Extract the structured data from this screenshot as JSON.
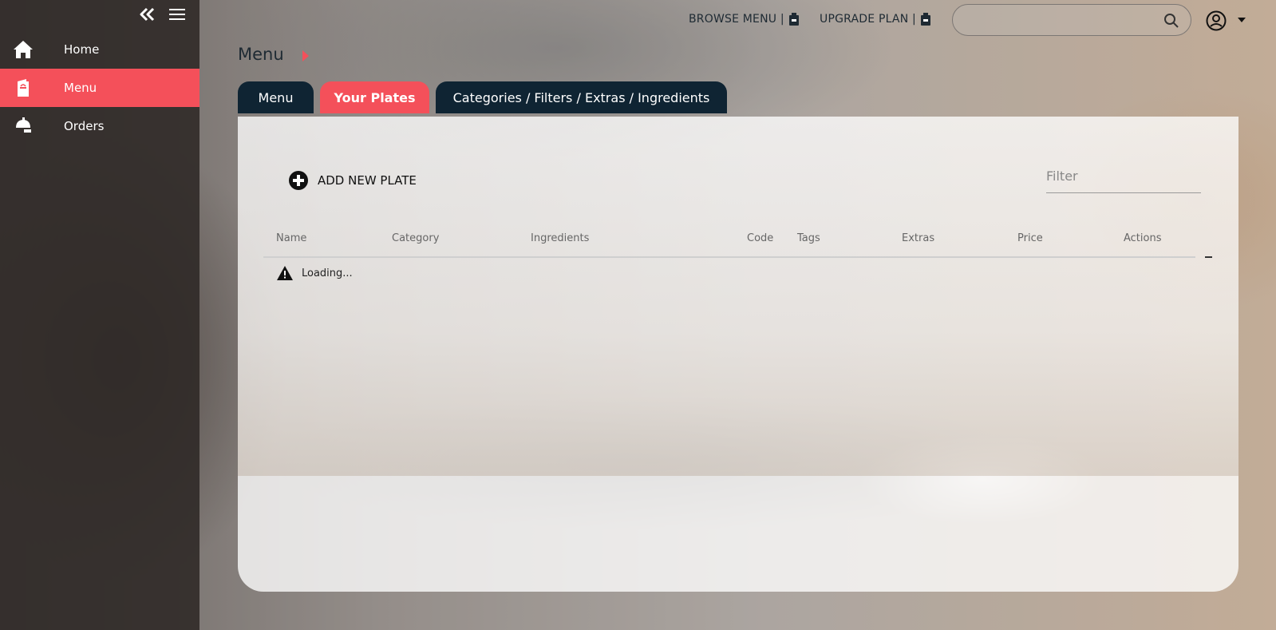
{
  "sidebar": {
    "items": [
      {
        "label": "Home",
        "icon": "home-icon"
      },
      {
        "label": "Menu",
        "icon": "menu-book-icon"
      },
      {
        "label": "Orders",
        "icon": "room-service-icon"
      }
    ],
    "active_index": 1
  },
  "topbar": {
    "browse_menu": "BROWSE MENU |",
    "upgrade_plan": "UPGRADE PLAN |",
    "search_placeholder": ""
  },
  "page": {
    "title": "Menu"
  },
  "tabs": [
    {
      "label": "Menu"
    },
    {
      "label": "Your Plates",
      "active": true
    },
    {
      "label": "Categories / Filters / Extras / Ingredients"
    }
  ],
  "panel": {
    "add_new_plate": "ADD NEW PLATE",
    "filter_placeholder": "Filter",
    "columns": [
      "Name",
      "Category",
      "Ingredients",
      "Code",
      "Tags",
      "Extras",
      "Price",
      "Actions"
    ],
    "loading_text": "Loading..."
  },
  "colors": {
    "accent": "#f4505a",
    "dark": "#0f2433"
  }
}
